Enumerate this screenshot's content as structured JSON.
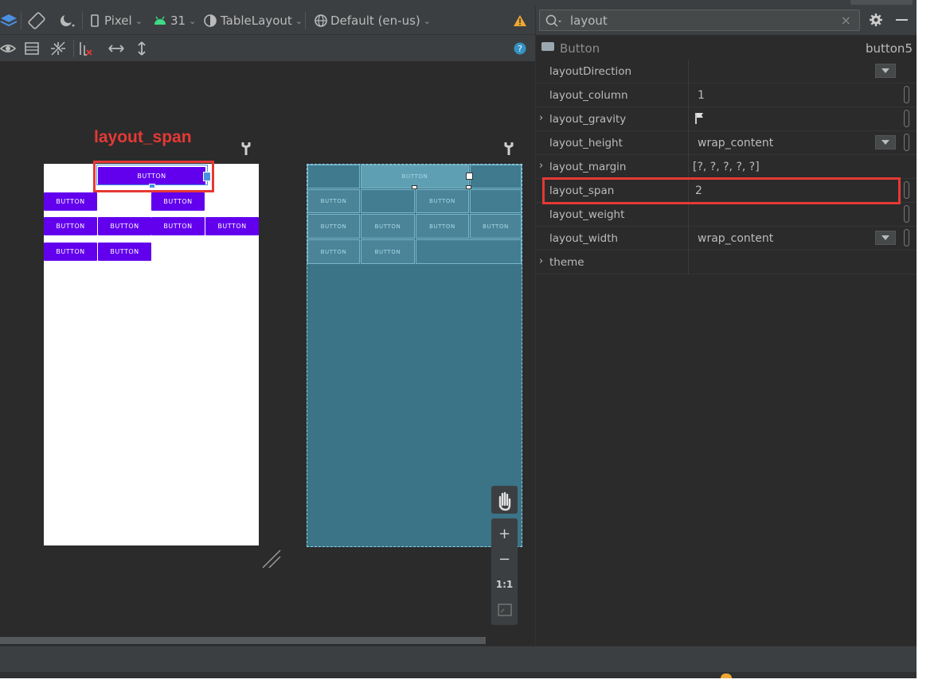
{
  "toolbar": {
    "device": "Pixel",
    "api_level": "31",
    "layout_name": "TableLayout",
    "locale": "Default (en-us)"
  },
  "annotation": {
    "label": "layout_span"
  },
  "design_buttons": {
    "label": "BUTTON"
  },
  "zoom": {
    "zoom_in": "+",
    "zoom_out": "−",
    "actual_size": "1:1"
  },
  "attributes": {
    "search_value": "layout",
    "component_type": "Button",
    "component_id": "button5",
    "rows": [
      {
        "name": "layoutDirection",
        "value": "",
        "expandable": false
      },
      {
        "name": "layout_column",
        "value": "1",
        "expandable": false
      },
      {
        "name": "layout_gravity",
        "value": "",
        "expandable": true
      },
      {
        "name": "layout_height",
        "value": "wrap_content",
        "expandable": false
      },
      {
        "name": "layout_margin",
        "value": "[?, ?, ?, ?, ?]",
        "expandable": true
      },
      {
        "name": "layout_span",
        "value": "2",
        "expandable": false
      },
      {
        "name": "layout_weight",
        "value": "",
        "expandable": false
      },
      {
        "name": "layout_width",
        "value": "wrap_content",
        "expandable": false
      },
      {
        "name": "theme",
        "value": "",
        "expandable": true
      }
    ]
  },
  "colors": {
    "accent_button": "#6200ee",
    "blueprint": "#3b7387",
    "annotation_red": "#e53935",
    "warning": "#f0a732"
  }
}
